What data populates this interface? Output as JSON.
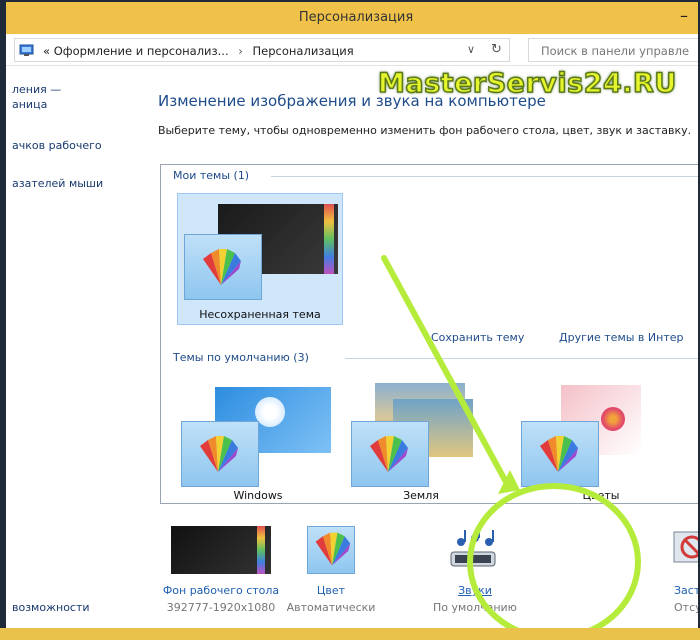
{
  "window": {
    "title": "Персонализация",
    "minimize_glyph": "–"
  },
  "address": {
    "prefix": "«",
    "crumb1": "Оформление и персонализ...",
    "separator": "›",
    "crumb2": "Персонализация",
    "dropdown_glyph": "∨",
    "refresh_glyph": "↻",
    "search_placeholder": "Поиск в панели управле"
  },
  "sidebar": {
    "items": [
      {
        "label": "ления —"
      },
      {
        "label": "аница"
      },
      {
        "label": "ачков рабочего"
      },
      {
        "label": "азателей мыши"
      },
      {
        "label": "возможности"
      }
    ]
  },
  "main": {
    "title": "Изменение изображения и звука на компьютере",
    "description": "Выберите тему, чтобы одновременно изменить фон рабочего стола, цвет, звук и заставку."
  },
  "themes": {
    "my_group": "Мои темы (1)",
    "unsaved_theme": "Несохраненная тема",
    "save_link": "Сохранить тему",
    "more_link": "Другие темы в Интер",
    "default_group": "Темы по умолчанию (3)",
    "defaults": [
      {
        "label": "Windows"
      },
      {
        "label": "Земля"
      },
      {
        "label": "Цветы"
      }
    ]
  },
  "bottom": [
    {
      "title": "Фон рабочего стола",
      "subtitle": "392777-1920x1080"
    },
    {
      "title": "Цвет",
      "subtitle": "Автоматически"
    },
    {
      "title": "Звуки",
      "subtitle": "По умолчанию"
    },
    {
      "title": "Заст",
      "subtitle": "Отсут"
    }
  ],
  "watermark": "MasterServis24.RU",
  "colors": {
    "accent": "#1e4c8a",
    "titlebar": "#f0c24a",
    "selection": "#cfe6fb",
    "annotation": "#b5ec3c"
  }
}
